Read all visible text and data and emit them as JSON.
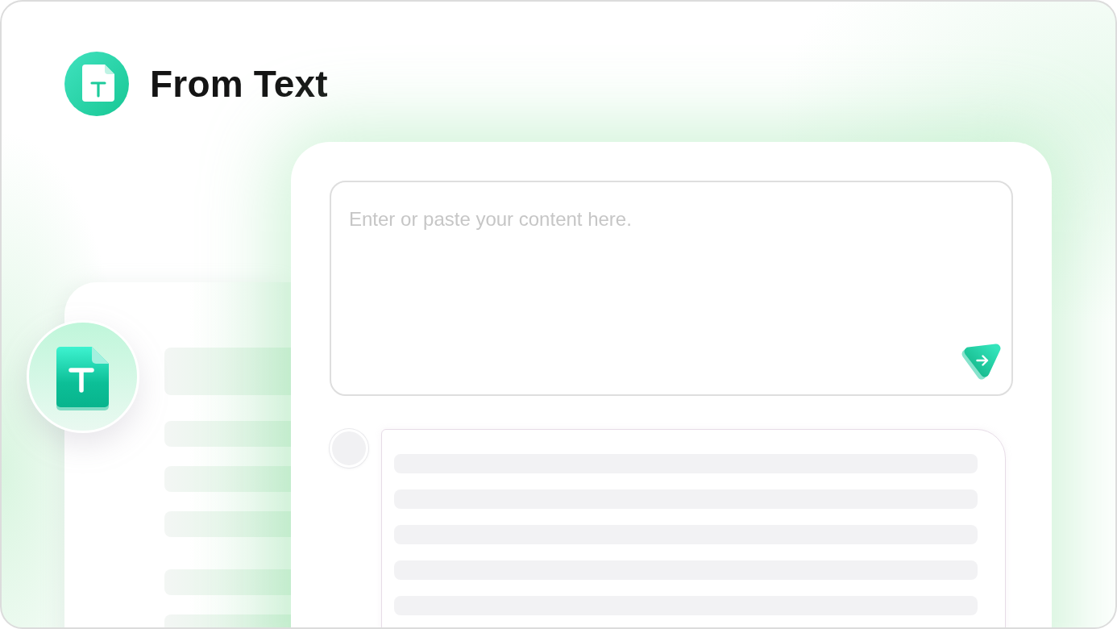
{
  "header": {
    "title": "From Text"
  },
  "composer": {
    "placeholder": "Enter or paste your content here."
  }
}
